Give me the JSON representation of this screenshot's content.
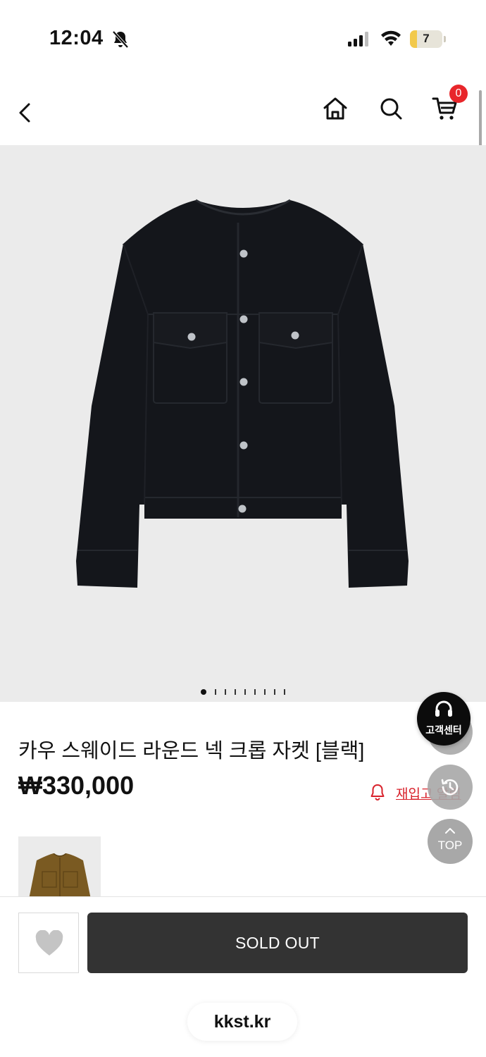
{
  "status_bar": {
    "time": "12:04",
    "battery_percent": "7",
    "icons": [
      "bell-slash-icon",
      "cellular-signal-icon",
      "wifi-icon",
      "battery-icon"
    ]
  },
  "header": {
    "icons": [
      "chevron-left-icon",
      "home-icon",
      "search-icon",
      "cart-icon"
    ],
    "cart_count": "0"
  },
  "gallery": {
    "image": "black-suede-jacket",
    "background": "#ebebeb",
    "current_slide": 1,
    "total_slides": 9
  },
  "product": {
    "title": "카우 스웨이드 라운드 넥 크롭 자켓 [블랙]",
    "price": "₩330,000",
    "restock_label": "재입고 알림"
  },
  "floating": {
    "customer_center_label": "고객센터",
    "top_label": "TOP"
  },
  "related": {
    "thumbnail": "brown-suede-jacket"
  },
  "bottom_bar": {
    "sold_out_label": "SOLD OUT",
    "url": "kkst.kr"
  },
  "colors": {
    "accent_red": "#d8202a",
    "badge_red": "#e8262b",
    "button_dark": "#333333"
  }
}
